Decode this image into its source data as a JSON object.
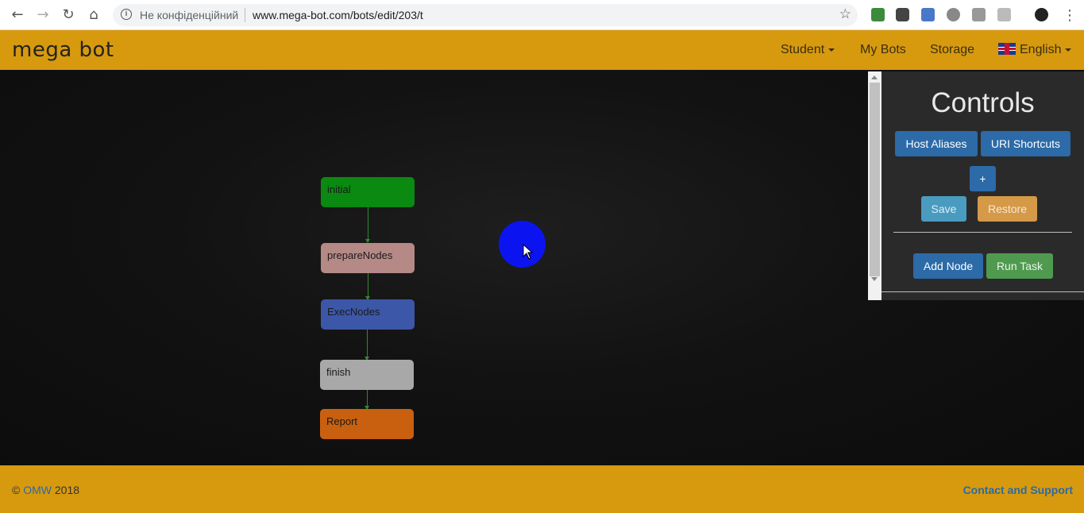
{
  "browser": {
    "security_label": "Не конфіденційний",
    "url": "www.mega-bot.com/bots/edit/203/t",
    "info_glyph": "i"
  },
  "header": {
    "logo": "mega bot",
    "nav": {
      "student": "Student",
      "my_bots": "My Bots",
      "storage": "Storage",
      "language": "English"
    }
  },
  "graph": {
    "nodes": [
      {
        "label": "initial",
        "color": "#0a8a10"
      },
      {
        "label": "prepareNodes",
        "color": "#b58986"
      },
      {
        "label": "ExecNodes",
        "color": "#3c57a8"
      },
      {
        "label": "finish",
        "color": "#a8a8a8"
      },
      {
        "label": "Report",
        "color": "#c9600f"
      }
    ],
    "edge_color": "#2f8a2f"
  },
  "controls": {
    "title": "Controls",
    "host_aliases": "Host Aliases",
    "uri_shortcuts": "URI Shortcuts",
    "plus": "+",
    "save": "Save",
    "restore": "Restore",
    "add_node": "Add Node",
    "run_task": "Run Task"
  },
  "footer": {
    "copyright_symbol": "©",
    "company": "OMW",
    "year": "2018",
    "contact": "Contact and Support"
  },
  "colors": {
    "brand": "#d79a0e",
    "primary": "#2c6aa8",
    "cursor_highlight": "#0b14f0"
  }
}
